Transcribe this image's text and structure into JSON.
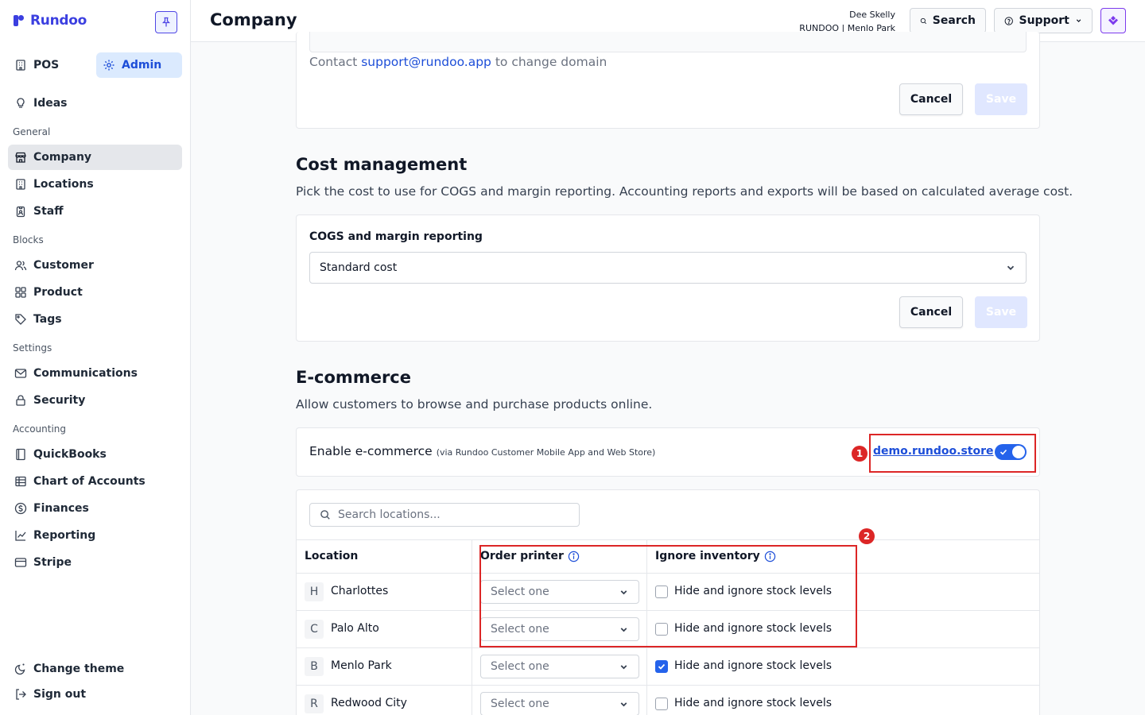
{
  "brand": {
    "name": "Rundoo",
    "color": "#3b3fe0"
  },
  "sidebar": {
    "modes": [
      {
        "label": "POS",
        "icon": "building-icon"
      },
      {
        "label": "Admin",
        "icon": "gear-icon",
        "active": true
      }
    ],
    "top_items": [
      {
        "label": "Ideas",
        "icon": "lightbulb-icon"
      }
    ],
    "sections": [
      {
        "title": "General",
        "items": [
          {
            "label": "Company",
            "icon": "store-icon",
            "active": true
          },
          {
            "label": "Locations",
            "icon": "building-icon"
          },
          {
            "label": "Staff",
            "icon": "badge-icon"
          }
        ]
      },
      {
        "title": "Blocks",
        "items": [
          {
            "label": "Customer",
            "icon": "users-icon"
          },
          {
            "label": "Product",
            "icon": "grid-icon"
          },
          {
            "label": "Tags",
            "icon": "tag-icon"
          }
        ]
      },
      {
        "title": "Settings",
        "items": [
          {
            "label": "Communications",
            "icon": "mail-icon"
          },
          {
            "label": "Security",
            "icon": "lock-icon"
          }
        ]
      },
      {
        "title": "Accounting",
        "items": [
          {
            "label": "QuickBooks",
            "icon": "book-icon"
          },
          {
            "label": "Chart of Accounts",
            "icon": "table-icon"
          },
          {
            "label": "Finances",
            "icon": "dollar-icon"
          },
          {
            "label": "Reporting",
            "icon": "line-chart-icon"
          },
          {
            "label": "Stripe",
            "icon": "credit-card-icon"
          }
        ]
      }
    ],
    "bottom_items": [
      {
        "label": "Change theme",
        "icon": "theme-icon"
      },
      {
        "label": "Sign out",
        "icon": "sign-out-icon"
      }
    ]
  },
  "header": {
    "title": "Company",
    "user_name": "Dee Skelly",
    "user_org": "RUNDOO | Menlo Park",
    "search_label": "Search",
    "support_label": "Support"
  },
  "domain_card": {
    "contact_prefix": "Contact ",
    "contact_email": "support@rundoo.app",
    "contact_suffix": " to change domain",
    "cancel_label": "Cancel",
    "save_label": "Save"
  },
  "cost_management": {
    "title": "Cost management",
    "description": "Pick the cost to use for COGS and margin reporting. Accounting reports and exports will be based on calculated average cost.",
    "field_label": "COGS and margin reporting",
    "selected_value": "Standard cost",
    "cancel_label": "Cancel",
    "save_label": "Save"
  },
  "ecommerce": {
    "title": "E-commerce",
    "description": "Allow customers to browse and purchase products online.",
    "enable_label": "Enable e-commerce",
    "enable_note": "(via Rundoo Customer Mobile App and Web Store)",
    "store_link": "demo.rundoo.store",
    "enabled": true,
    "search_placeholder": "Search locations...",
    "columns": {
      "location": "Location",
      "order_printer": "Order printer",
      "ignore_inventory": "Ignore inventory"
    },
    "rows": [
      {
        "badge": "H",
        "name": "Charlottes",
        "printer": "Select one",
        "ignore_label": "Hide and ignore stock levels",
        "ignore_checked": false
      },
      {
        "badge": "C",
        "name": "Palo Alto",
        "printer": "Select one",
        "ignore_label": "Hide and ignore stock levels",
        "ignore_checked": false
      },
      {
        "badge": "B",
        "name": "Menlo Park",
        "printer": "Select one",
        "ignore_label": "Hide and ignore stock levels",
        "ignore_checked": true
      },
      {
        "badge": "R",
        "name": "Redwood City",
        "printer": "Select one",
        "ignore_label": "Hide and ignore stock levels",
        "ignore_checked": false
      }
    ]
  },
  "annotations": [
    {
      "number": "1"
    },
    {
      "number": "2"
    }
  ],
  "colors": {
    "accent": "#2563eb",
    "annotation": "#dc2626",
    "admin_bg": "#dbeafe",
    "app_icon": "#7c3aed"
  }
}
